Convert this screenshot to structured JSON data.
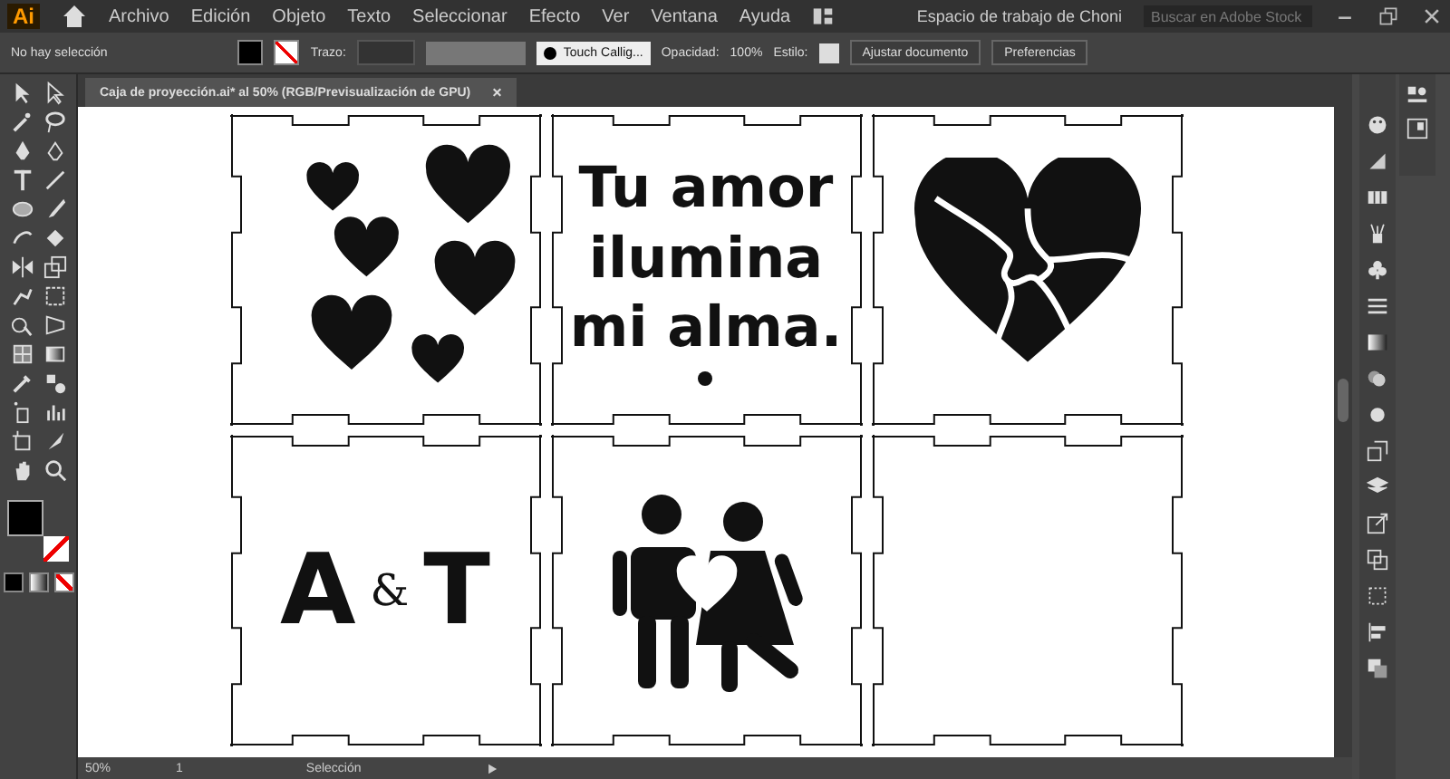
{
  "app": {
    "logo": "Ai"
  },
  "menu": [
    "Archivo",
    "Edición",
    "Objeto",
    "Texto",
    "Seleccionar",
    "Efecto",
    "Ver",
    "Ventana",
    "Ayuda"
  ],
  "workspace": "Espacio de trabajo de Choni",
  "search": {
    "placeholder": "Buscar en Adobe Stock"
  },
  "control_bar": {
    "selection": "No hay selección",
    "stroke_label": "Trazo:",
    "brush": "Touch Callig...",
    "opacity_label": "Opacidad:",
    "opacity": "100%",
    "style_label": "Estilo:",
    "buttons": [
      "Ajustar documento",
      "Preferencias"
    ]
  },
  "document_tab": {
    "title": "Caja de proyección.ai* al 50% (RGB/Previsualización de GPU)",
    "close": "×"
  },
  "tiles": [
    {
      "kind": "hearts"
    },
    {
      "kind": "text",
      "lines": [
        "Tu amor",
        "ilumina",
        "mi alma."
      ]
    },
    {
      "kind": "puzzle"
    },
    {
      "kind": "initials",
      "parts": [
        "A",
        "&",
        "T"
      ]
    },
    {
      "kind": "couple"
    },
    {
      "kind": "empty"
    }
  ],
  "status_bar": {
    "zoom": "50%",
    "artboard": "1",
    "tool": "Selección"
  }
}
